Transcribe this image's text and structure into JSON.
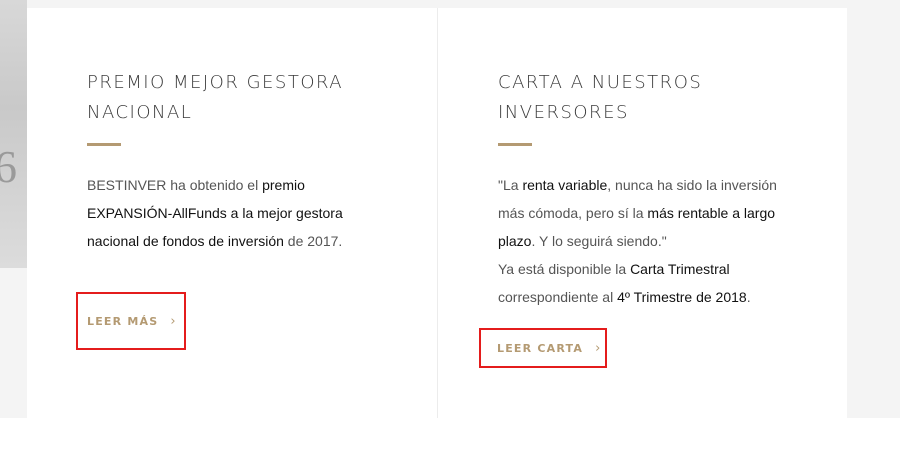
{
  "cards": [
    {
      "title": "PREMIO MEJOR GESTORA NACIONAL",
      "body": {
        "t1": "BESTINVER ha obtenido el ",
        "b1": "premio EXPANSIÓN-AllFunds a la mejor gestora nacional de fondos de inversión",
        "t2": " de 2017."
      },
      "cta": {
        "label": "LEER MÁS",
        "icon": "chevron-right-icon"
      }
    },
    {
      "title": "CARTA A NUESTROS INVERSORES",
      "body": {
        "t1": "\"La ",
        "b1": "renta variable",
        "t2": ", nunca ha sido la inversión más cómoda, pero sí la ",
        "b2": "más rentable a largo plazo",
        "t3": ". Y lo seguirá siendo.\"",
        "t4": "Ya está disponible la ",
        "b3": "Carta Trimestral",
        "t5": " correspondiente al ",
        "b4": "4º Trimestre de 2018",
        "t6": "."
      },
      "cta": {
        "label": "LEER CARTA",
        "icon": "chevron-right-icon"
      }
    }
  ],
  "background": {
    "digit": "6"
  },
  "colors": {
    "accent": "#b49a72",
    "highlight_border": "#e41c1c",
    "section_bg": "#f4f4f4",
    "card_bg": "#ffffff"
  }
}
